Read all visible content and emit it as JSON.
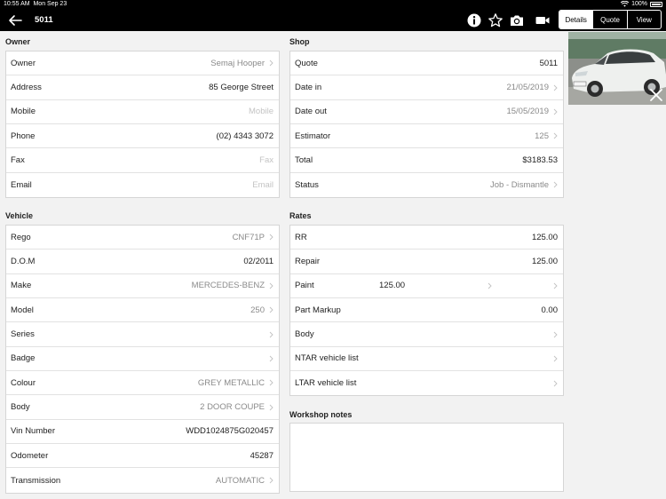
{
  "status_bar": {
    "time": "10:55 AM",
    "date": "Mon Sep 23",
    "battery": "100%"
  },
  "nav": {
    "title": "5011",
    "segments": [
      "Details",
      "Quote",
      "View"
    ],
    "active_segment": "Details"
  },
  "owner": {
    "title": "Owner",
    "rows": [
      {
        "label": "Owner",
        "value": "Semaj Hooper",
        "style": "muted",
        "chevron": true
      },
      {
        "label": "Address",
        "value": "85 George Street",
        "style": "normal",
        "chevron": false
      },
      {
        "label": "Mobile",
        "value": "Mobile",
        "style": "placeholder",
        "chevron": false
      },
      {
        "label": "Phone",
        "value": "(02) 4343 3072",
        "style": "normal",
        "chevron": false
      },
      {
        "label": "Fax",
        "value": "Fax",
        "style": "placeholder",
        "chevron": false
      },
      {
        "label": "Email",
        "value": "Email",
        "style": "placeholder",
        "chevron": false
      }
    ]
  },
  "shop": {
    "title": "Shop",
    "rows": [
      {
        "label": "Quote",
        "value": "5011",
        "style": "normal",
        "chevron": false
      },
      {
        "label": "Date in",
        "value": "21/05/2019",
        "style": "muted",
        "chevron": true
      },
      {
        "label": "Date out",
        "value": "15/05/2019",
        "style": "muted",
        "chevron": true
      },
      {
        "label": "Estimator",
        "value": "125",
        "style": "muted",
        "chevron": true
      },
      {
        "label": "Total",
        "value": "$3183.53",
        "style": "normal",
        "chevron": false
      },
      {
        "label": "Status",
        "value": "Job - Dismantle",
        "style": "muted",
        "chevron": true
      }
    ]
  },
  "vehicle": {
    "title": "Vehicle",
    "rows": [
      {
        "label": "Rego",
        "value": "CNF71P",
        "style": "muted",
        "chevron": true
      },
      {
        "label": "D.O.M",
        "value": "02/2011",
        "style": "normal",
        "chevron": false
      },
      {
        "label": "Make",
        "value": "MERCEDES-BENZ",
        "style": "muted",
        "chevron": true
      },
      {
        "label": "Model",
        "value": "250",
        "style": "muted",
        "chevron": true
      },
      {
        "label": "Series",
        "value": "",
        "style": "muted",
        "chevron": true
      },
      {
        "label": "Badge",
        "value": "",
        "style": "muted",
        "chevron": true
      },
      {
        "label": "Colour",
        "value": "GREY METALLIC",
        "style": "muted",
        "chevron": true
      },
      {
        "label": "Body",
        "value": "2 DOOR COUPE",
        "style": "muted",
        "chevron": true
      },
      {
        "label": "Vin Number",
        "value": "WDD1024875G020457",
        "style": "normal",
        "chevron": false
      },
      {
        "label": "Odometer",
        "value": "45287",
        "style": "normal",
        "chevron": false
      },
      {
        "label": "Transmission",
        "value": "AUTOMATIC",
        "style": "muted",
        "chevron": true
      }
    ]
  },
  "rates": {
    "title": "Rates",
    "rows": [
      {
        "label": "RR",
        "value": "125.00",
        "style": "normal",
        "chevron": false
      },
      {
        "label": "Repair",
        "value": "125.00",
        "style": "normal",
        "chevron": false
      },
      {
        "label": "Paint",
        "value": "",
        "mid_value": "125.00",
        "style": "normal",
        "chevron": true
      },
      {
        "label": "Part Markup",
        "value": "0.00",
        "style": "normal",
        "chevron": false
      },
      {
        "label": "Body",
        "value": "",
        "style": "normal",
        "chevron": true
      },
      {
        "label": "NTAR vehicle list",
        "value": "",
        "style": "normal",
        "chevron": true
      },
      {
        "label": "LTAR vehicle list",
        "value": "",
        "style": "normal",
        "chevron": true
      }
    ]
  },
  "notes": {
    "title": "Workshop notes",
    "value": ""
  },
  "icons": [
    "back-arrow-icon",
    "info-icon",
    "star-icon",
    "camera-icon",
    "video-icon",
    "close-icon",
    "chevron-right-icon",
    "wifi-icon",
    "battery-icon"
  ]
}
